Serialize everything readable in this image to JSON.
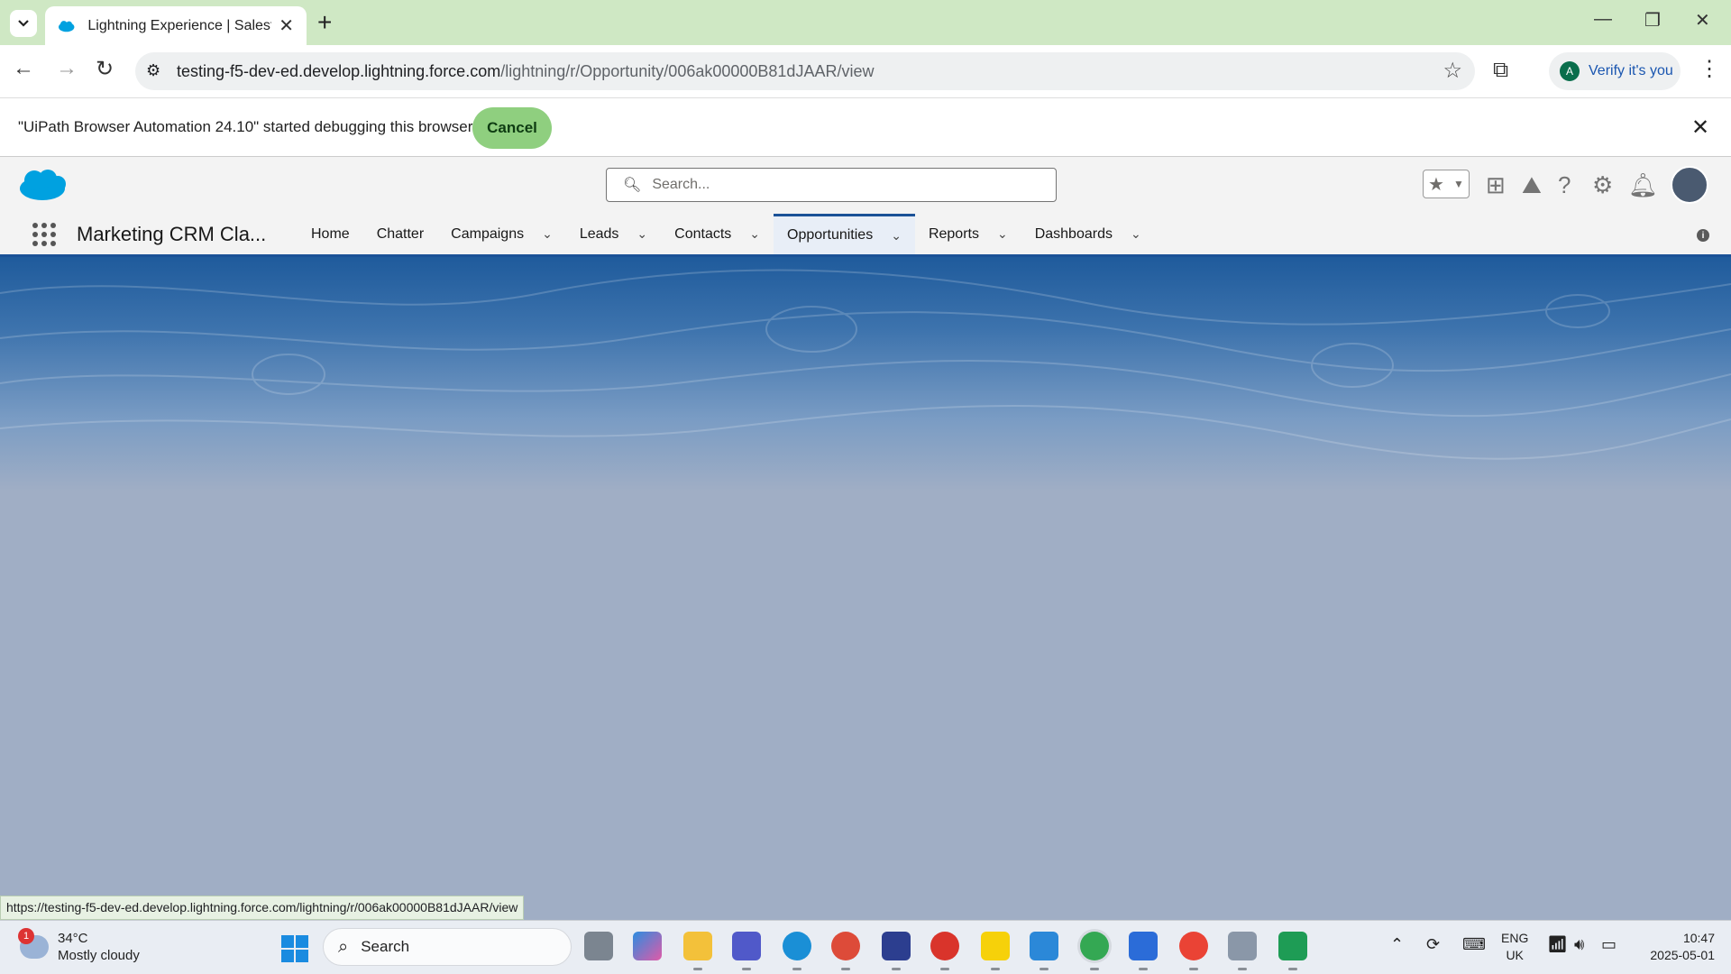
{
  "browser": {
    "tab_title": "Lightning Experience | Salesforc",
    "url_host": "testing-f5-dev-ed.develop.lightning.force.com",
    "url_path": "/lightning/r/Opportunity/006ak00000B81dJAAR/view",
    "verify_label": "Verify it's you",
    "profile_initial": "A"
  },
  "debug_bar": {
    "message": "\"UiPath Browser Automation 24.10\" started debugging this browser",
    "cancel_label": "Cancel"
  },
  "salesforce": {
    "search_placeholder": "Search...",
    "app_name": "Marketing CRM Cla...",
    "nav": [
      {
        "label": "Home",
        "dropdown": false
      },
      {
        "label": "Chatter",
        "dropdown": false
      },
      {
        "label": "Campaigns",
        "dropdown": true
      },
      {
        "label": "Leads",
        "dropdown": true
      },
      {
        "label": "Contacts",
        "dropdown": true
      },
      {
        "label": "Opportunities",
        "dropdown": true,
        "active": true
      },
      {
        "label": "Reports",
        "dropdown": true
      },
      {
        "label": "Dashboards",
        "dropdown": true
      }
    ],
    "brand_color": "#1b5297"
  },
  "status_bar_url": "https://testing-f5-dev-ed.develop.lightning.force.com/lightning/r/006ak00000B81dJAAR/view",
  "taskbar": {
    "weather_badge": "1",
    "temperature": "34°C",
    "weather": "Mostly cloudy",
    "search_label": "Search",
    "language": "ENG",
    "region": "UK",
    "time": "10:47",
    "date": "2025-05-01"
  }
}
